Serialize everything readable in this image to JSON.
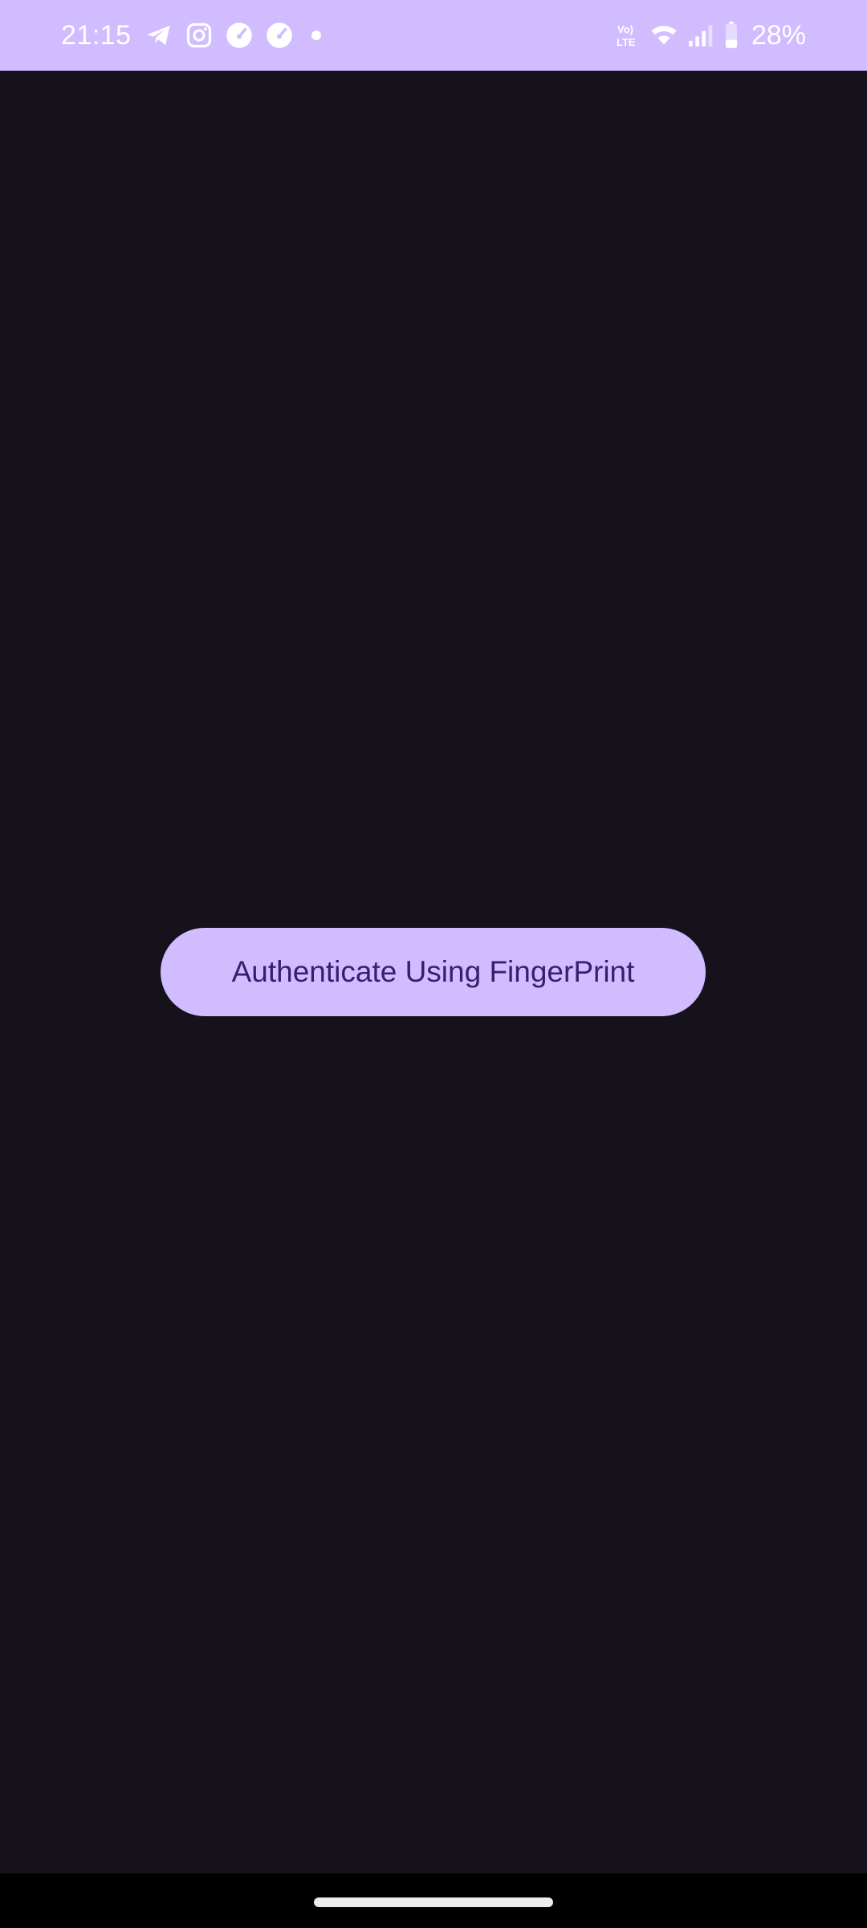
{
  "status_bar": {
    "time": "21:15",
    "left_icons": [
      "telegram-icon",
      "instagram-icon",
      "speedometer-icon",
      "speedometer-icon",
      "notification-dot"
    ],
    "right_icons": [
      "volte-icon",
      "wifi-icon",
      "cellular-signal-icon",
      "battery-icon"
    ],
    "battery_percent": "28%",
    "background_color": "#d0bcff"
  },
  "main": {
    "background_color": "#15121b",
    "auth_button_label": "Authenticate Using FingerPrint",
    "auth_button_color": "#d0bcff",
    "auth_button_text_color": "#381e72"
  },
  "nav_bar": {
    "background_color": "#000000"
  }
}
